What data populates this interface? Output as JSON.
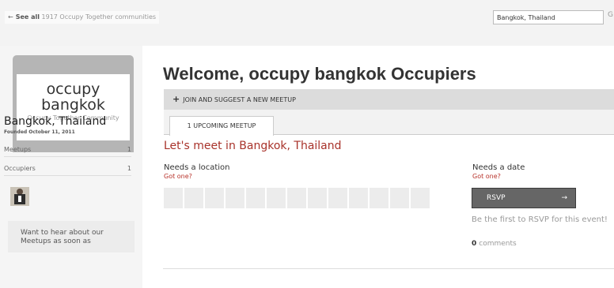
{
  "topbar": {
    "see_all_arrow": "←",
    "see_all_prefix": "See all",
    "see_all_text": "1917 Occupy Together communities",
    "search_value": "Bangkok, Thailand",
    "search_button": "G"
  },
  "sidebar": {
    "logo_title": "occupy bangkok",
    "logo_subtitle": "Occupy Together Community",
    "city": "Bangkok, Thailand",
    "founded": "Founded October 11, 2011",
    "stats": [
      {
        "label": "Meetups",
        "count": "1"
      },
      {
        "label": "Occupiers",
        "count": "1"
      }
    ],
    "notify_text": "Want to hear about our Meetups as soon as"
  },
  "main": {
    "welcome": "Welcome, occupy bangkok Occupiers",
    "join_icon": "+",
    "join_label": "JOIN AND SUGGEST A NEW MEETUP",
    "tab_label": "1 UPCOMING MEETUP",
    "meetup_title": "Let's meet in Bangkok, Thailand",
    "location": {
      "label": "Needs a location",
      "link": "Got one?"
    },
    "date": {
      "label": "Needs a date",
      "link": "Got one?"
    },
    "rsvp_label": "RSVP",
    "rsvp_chevron": "→",
    "first_rsvp": "Be the first to RSVP for this event!",
    "comments_count": "0",
    "comments_label": "comments"
  },
  "colors": {
    "accent_red": "#a8322a",
    "link_red": "#b8332b",
    "rsvp_button": "#666666"
  },
  "icons": [
    "back-arrow-icon",
    "plus-icon",
    "arrow-right-icon"
  ]
}
